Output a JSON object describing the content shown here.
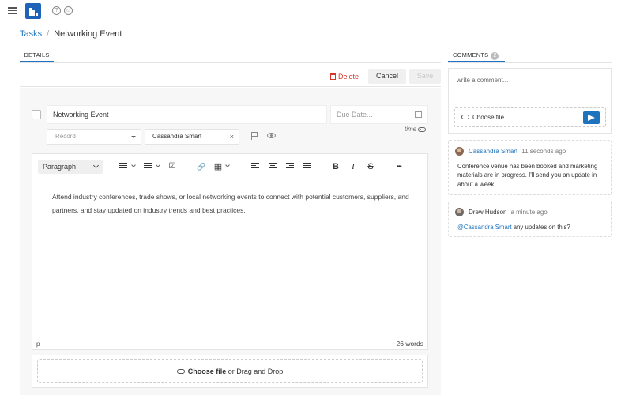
{
  "topbar": {
    "menu_icon": "hamburger-icon",
    "logo": "app-logo",
    "help_icon": "help-icon",
    "help_glyph": "?",
    "feedback_icon": "smile-icon",
    "feedback_glyph": "☺"
  },
  "breadcrumb": {
    "parent": "Tasks",
    "separator": "/",
    "current": "Networking Event"
  },
  "details": {
    "tab_label": "DETAILS",
    "delete_label": "Delete",
    "cancel_label": "Cancel",
    "save_label": "Save",
    "title_value": "Networking Event",
    "due_date_placeholder": "Due Date...",
    "time_toggle_label": "time",
    "record_placeholder": "Record",
    "assignee_value": "Cassandra Smart",
    "assignee_clear": "×"
  },
  "editor": {
    "block_format": "Paragraph",
    "toolbar": {
      "bold": "B",
      "italic": "I",
      "strike": "S",
      "more": "•••",
      "link": "🔗",
      "task_list": "☑",
      "table": "▦"
    },
    "body_text": "Attend industry conferences, trade shows, or local networking events to connect with potential customers, suppliers, and partners, and stay updated on industry trends and best practices.",
    "status_element": "p",
    "word_count": "26 words"
  },
  "attachments": {
    "choose_file_label": "Choose file",
    "drag_drop_label": " or Drag and Drop"
  },
  "comments": {
    "tab_label": "COMMENTS",
    "count": "2",
    "input_placeholder": "write a comment...",
    "choose_file_label": "Choose file",
    "items": [
      {
        "author": "Cassandra Smart",
        "time": "11 seconds ago",
        "text": "Conference venue has been booked and marketing materials are in progress. I'll send you an update in about a week."
      },
      {
        "author": "Drew Hudson",
        "time": "a minute ago",
        "mention": "@Cassandra Smart",
        "text": " any updates on this?"
      }
    ]
  },
  "colors": {
    "accent": "#1e73be",
    "logo": "#1e63b8",
    "danger": "#d9342b"
  }
}
